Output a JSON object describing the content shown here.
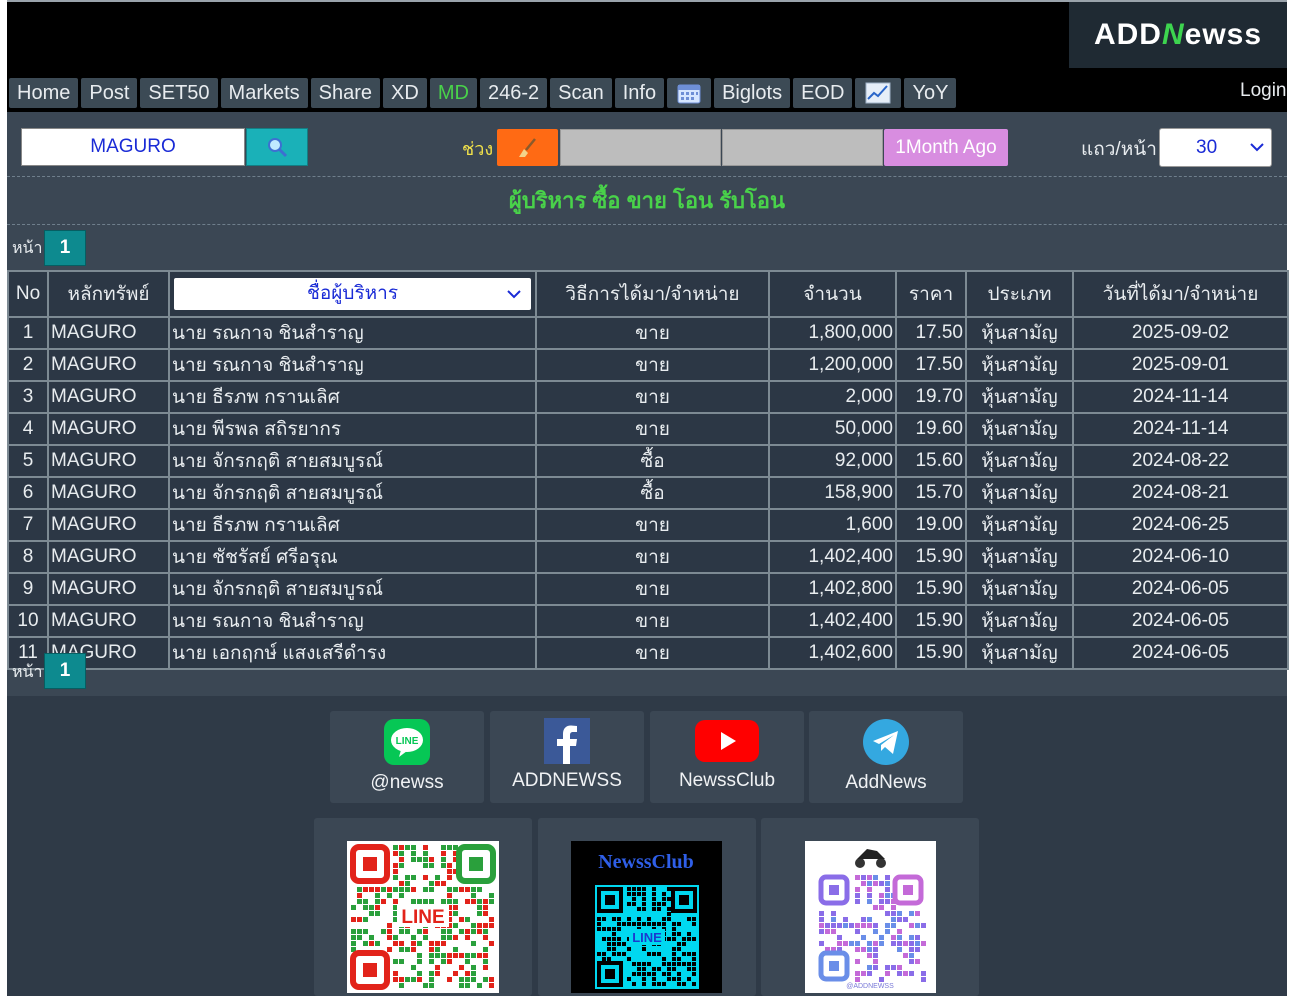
{
  "logo": {
    "text_pre": "ADD",
    "text_n": "N",
    "text_post": "ewss"
  },
  "nav": {
    "tabs": [
      {
        "label": "Home"
      },
      {
        "label": "Post"
      },
      {
        "label": "SET50"
      },
      {
        "label": "Markets"
      },
      {
        "label": "Share"
      },
      {
        "label": "XD"
      },
      {
        "label": "MD",
        "active": true
      },
      {
        "label": "246-2"
      },
      {
        "label": "Scan"
      },
      {
        "label": "Info"
      },
      {
        "icon": "calendar-icon"
      },
      {
        "label": "Biglots"
      },
      {
        "label": "EOD"
      },
      {
        "icon": "chart-icon"
      },
      {
        "label": "YoY"
      }
    ],
    "login": "Login"
  },
  "filter": {
    "symbol": "MAGURO",
    "range_label": "ช่วง",
    "month_button": "1Month Ago",
    "rows_label": "แถว/หน้า",
    "rows_value": "30"
  },
  "title": "ผู้บริหาร ซื้อ ขาย โอน รับโอน",
  "pager": {
    "label": "หน้า",
    "page": "1"
  },
  "table": {
    "headers": {
      "no": "No",
      "symbol": "หลักทรัพย์",
      "name": "ชื่อผู้บริหาร",
      "method": "วิธีการได้มา/จำหน่าย",
      "amount": "จำนวน",
      "price": "ราคา",
      "type": "ประเภท",
      "date": "วันที่ได้มา/จำหน่าย"
    },
    "rows": [
      {
        "no": "1",
        "symbol": "MAGURO",
        "name": "นาย รณกาจ ชินสำราญ",
        "method": "ขาย",
        "amount": "1,800,000",
        "price": "17.50",
        "type": "หุ้นสามัญ",
        "date": "2025-09-02"
      },
      {
        "no": "2",
        "symbol": "MAGURO",
        "name": "นาย รณกาจ ชินสำราญ",
        "method": "ขาย",
        "amount": "1,200,000",
        "price": "17.50",
        "type": "หุ้นสามัญ",
        "date": "2025-09-01"
      },
      {
        "no": "3",
        "symbol": "MAGURO",
        "name": "นาย ธีรภพ กรานเลิศ",
        "method": "ขาย",
        "amount": "2,000",
        "price": "19.70",
        "type": "หุ้นสามัญ",
        "date": "2024-11-14"
      },
      {
        "no": "4",
        "symbol": "MAGURO",
        "name": "นาย พีรพล สถิรยากร",
        "method": "ขาย",
        "amount": "50,000",
        "price": "19.60",
        "type": "หุ้นสามัญ",
        "date": "2024-11-14"
      },
      {
        "no": "5",
        "symbol": "MAGURO",
        "name": "นาย จักรกฤติ สายสมบูรณ์",
        "method": "ซื้อ",
        "amount": "92,000",
        "price": "15.60",
        "type": "หุ้นสามัญ",
        "date": "2024-08-22"
      },
      {
        "no": "6",
        "symbol": "MAGURO",
        "name": "นาย จักรกฤติ สายสมบูรณ์",
        "method": "ซื้อ",
        "amount": "158,900",
        "price": "15.70",
        "type": "หุ้นสามัญ",
        "date": "2024-08-21"
      },
      {
        "no": "7",
        "symbol": "MAGURO",
        "name": "นาย ธีรภพ กรานเลิศ",
        "method": "ขาย",
        "amount": "1,600",
        "price": "19.00",
        "type": "หุ้นสามัญ",
        "date": "2024-06-25"
      },
      {
        "no": "8",
        "symbol": "MAGURO",
        "name": "นาย ชัชรัสย์ ศรีอรุณ",
        "method": "ขาย",
        "amount": "1,402,400",
        "price": "15.90",
        "type": "หุ้นสามัญ",
        "date": "2024-06-10"
      },
      {
        "no": "9",
        "symbol": "MAGURO",
        "name": "นาย จักรกฤติ สายสมบูรณ์",
        "method": "ขาย",
        "amount": "1,402,800",
        "price": "15.90",
        "type": "หุ้นสามัญ",
        "date": "2024-06-05"
      },
      {
        "no": "10",
        "symbol": "MAGURO",
        "name": "นาย รณกาจ ชินสำราญ",
        "method": "ขาย",
        "amount": "1,402,400",
        "price": "15.90",
        "type": "หุ้นสามัญ",
        "date": "2024-06-05"
      },
      {
        "no": "11",
        "symbol": "MAGURO",
        "name": "นาย เอกฤกษ์ แสงเสรีดำรง",
        "method": "ขาย",
        "amount": "1,402,600",
        "price": "15.90",
        "type": "หุ้นสามัญ",
        "date": "2024-06-05"
      }
    ]
  },
  "social": [
    {
      "icon": "line-icon",
      "label": "@newss"
    },
    {
      "icon": "facebook-icon",
      "label": "ADDNEWSS"
    },
    {
      "icon": "youtube-icon",
      "label": "NewssClub"
    },
    {
      "icon": "telegram-icon",
      "label": "AddNews"
    }
  ],
  "qr_cards": [
    {
      "icon": "line-qr-code",
      "caption": "LINE"
    },
    {
      "icon": "newssclub-line-qr-code",
      "title": "NewssClub",
      "caption": "LINE"
    },
    {
      "icon": "addnewss-qr-code",
      "caption": "@ADDNEWSS"
    }
  ],
  "colors": {
    "accent_green": "#49d24a",
    "sell_pink": "#ff9e9e",
    "date_green": "#9ade3a",
    "type_blue": "#6fb6e6",
    "panel": "#3b4754",
    "table_bg": "#2c3745",
    "teal_button": "#1ab1b8",
    "orange_button": "#ff6a14",
    "pink_button": "#d88de0"
  }
}
